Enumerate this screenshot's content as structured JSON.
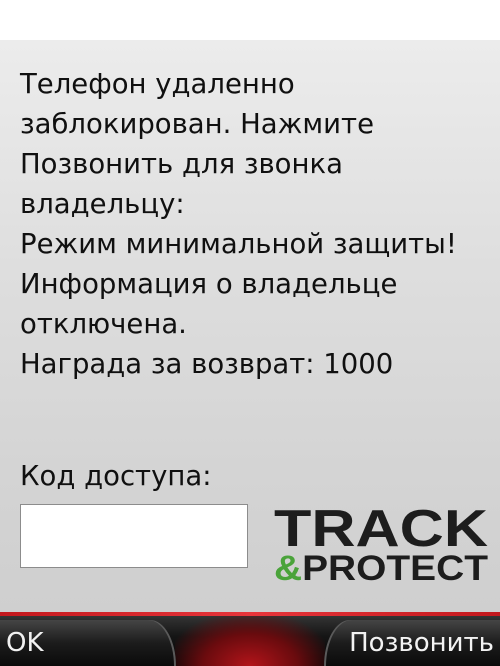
{
  "message": {
    "lines": [
      "Телефон удаленно",
      "заблокирован. Нажмите",
      "Позвонить для звонка",
      "владельцу:",
      "Режим минимальной защиты!",
      "Информация о владельце",
      "отключена.",
      "Награда за возврат: 1000"
    ]
  },
  "access_code": {
    "label": "Код доступа:",
    "value": ""
  },
  "logo": {
    "word_top": "TRACK",
    "word_bottom_amp": "&",
    "word_bottom": "PROTECT",
    "colors": {
      "dark": "#1d1d1d",
      "green": "#4aa33a"
    }
  },
  "softkeys": {
    "left_label": "OK",
    "right_label": "Позвонить"
  },
  "colors": {
    "softkey_accent": "#d9262c",
    "background": "#dcdcdc"
  }
}
